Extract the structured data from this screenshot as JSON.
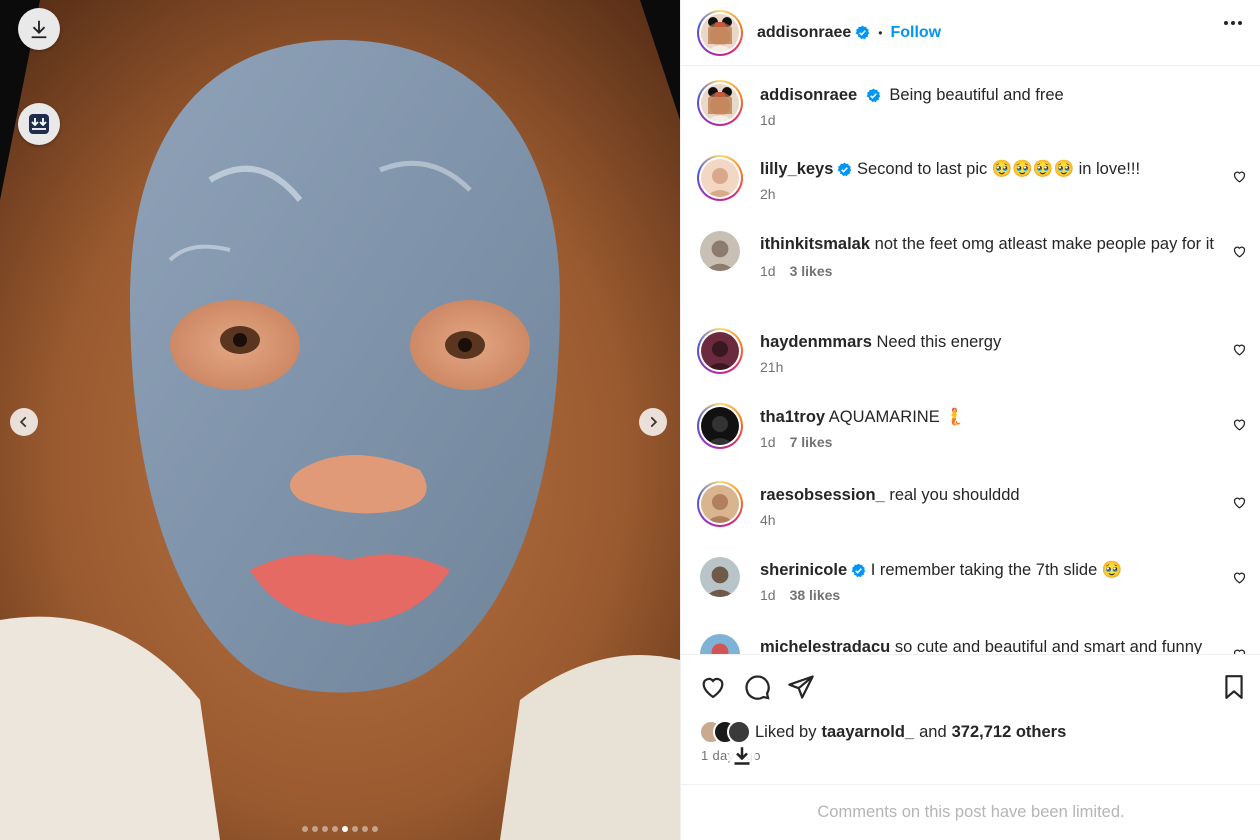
{
  "post": {
    "author": "addisonraee",
    "follow_label": "Follow",
    "separator": "•",
    "caption": "Being beautiful and free",
    "caption_time": "1d",
    "slide_count": 8,
    "active_slide": 5
  },
  "comments": [
    {
      "user": "lilly_keys",
      "verified": true,
      "text": "Second to last pic 🥹🥹🥹🥹 in love!!!",
      "time": "2h",
      "likes": ""
    },
    {
      "user": "ithinkitsmalak",
      "verified": false,
      "text": "not the feet omg atleast make people pay for it",
      "time": "1d",
      "likes": "3 likes"
    },
    {
      "user": "haydenmmars",
      "verified": false,
      "text": "Need this energy",
      "time": "21h",
      "likes": ""
    },
    {
      "user": "tha1troy",
      "verified": false,
      "text": "AQUAMARINE 🧜",
      "time": "1d",
      "likes": "7 likes"
    },
    {
      "user": "raesobsession_",
      "verified": false,
      "text": "real you shoulddd",
      "time": "4h",
      "likes": ""
    },
    {
      "user": "sherinicole",
      "verified": true,
      "text": "I remember taking the 7th slide 🥹",
      "time": "1d",
      "likes": "38 likes"
    },
    {
      "user": "michelestradacu",
      "verified": false,
      "text": "so cute and beautiful and smart and funny",
      "time": "",
      "likes": ""
    }
  ],
  "likes": {
    "prefix": "Liked by",
    "user": "taayarnold_",
    "and": "and",
    "count": "372,712 others"
  },
  "ago": "1 day ago",
  "limited_text": "Comments on this post have been limited.",
  "colors": {
    "link": "#0095f6",
    "verified": "#0095f6",
    "text": "#262626",
    "muted": "#737373"
  },
  "icons": [
    "download-icon",
    "save-media-icon",
    "chevron-left-icon",
    "chevron-right-icon",
    "more-icon",
    "heart-icon",
    "comment-icon",
    "share-icon",
    "bookmark-icon",
    "verified-badge-icon"
  ]
}
